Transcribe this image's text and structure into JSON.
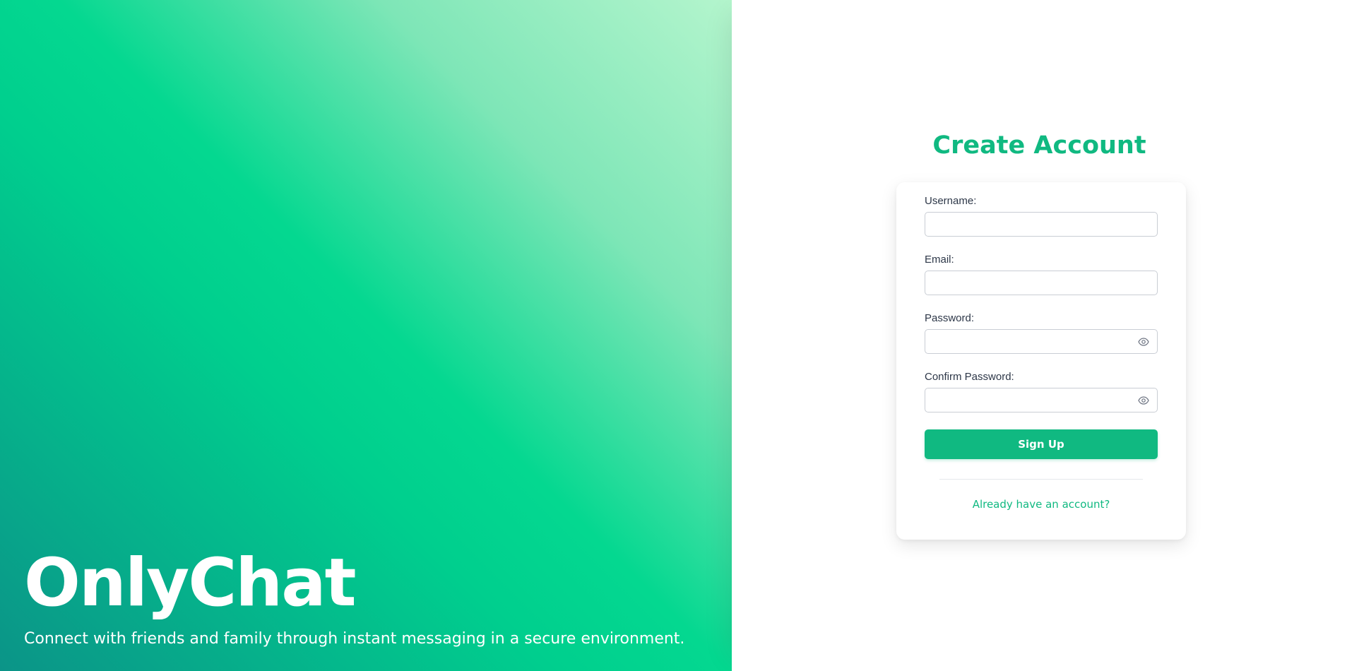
{
  "hero": {
    "brand": "OnlyChat",
    "tagline": "Connect with friends and family through instant messaging in a secure environment."
  },
  "form": {
    "title": "Create Account",
    "username": {
      "label": "Username:",
      "value": ""
    },
    "email": {
      "label": "Email:",
      "value": ""
    },
    "password": {
      "label": "Password:",
      "value": "",
      "icon": "eye-icon"
    },
    "confirm_password": {
      "label": "Confirm Password:",
      "value": "",
      "icon": "eye-icon"
    },
    "submit_label": "Sign Up",
    "login_link": "Already have an account?"
  },
  "colors": {
    "accent": "#10b981",
    "gradient_start": "#0b9488",
    "gradient_mid": "#04d890",
    "gradient_end": "#b4f5cd"
  }
}
